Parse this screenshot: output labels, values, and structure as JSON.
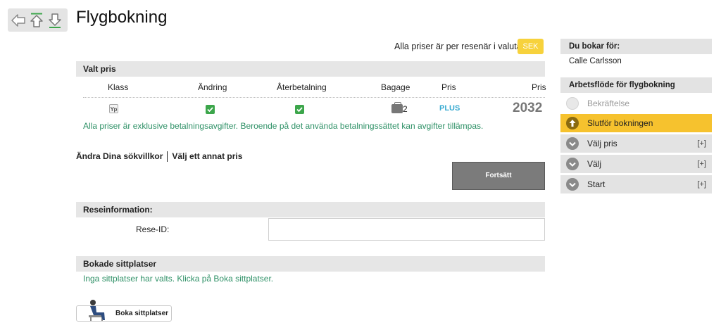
{
  "page": {
    "title": "Flygbokning"
  },
  "pricing": {
    "note": "Alla priser är per resenär i valuta",
    "currency": "SEK"
  },
  "selected_price": {
    "header": "Valt pris",
    "columns": [
      "Klass",
      "Ändring",
      "Återbetalning",
      "Bagage",
      "Pris",
      "Pris"
    ],
    "row": {
      "class_code": "Yp",
      "baggage_count": "2",
      "fare_name": "PLUS",
      "price": "2032"
    },
    "fee_note": "Alla priser är exklusive betalningsavgifter. Beroende på det använda betalningssättet kan avgifter tillämpas."
  },
  "links": {
    "change_search": "Ändra Dina sökvillkor",
    "choose_other_price": "Välj ett annat pris"
  },
  "continue_button": "Fortsätt",
  "travel_info": {
    "header": "Reseinformation:",
    "trip_id_label": "Rese-ID:",
    "trip_id_value": ""
  },
  "seats": {
    "header": "Bokade sittplatser",
    "note": "Inga sittplatser har valts. Klicka på Boka sittplatser.",
    "button": "Boka sittplatser"
  },
  "sidebar": {
    "booking_for_header": "Du bokar för:",
    "user_name": "Calle Carlsson",
    "workflow_header": "Arbetsflöde för flygbokning",
    "steps": [
      {
        "label": "Bekräftelse",
        "state": "pending",
        "expand": ""
      },
      {
        "label": "Slutför bokningen",
        "state": "current",
        "expand": ""
      },
      {
        "label": "Välj pris",
        "state": "done",
        "expand": "[+]"
      },
      {
        "label": "Välj",
        "state": "done",
        "expand": "[+]"
      },
      {
        "label": "Start",
        "state": "done",
        "expand": "[+]"
      }
    ]
  },
  "colors": {
    "accent_yellow": "#f6c22e",
    "note_green": "#2f9167",
    "fare_blue": "#35a9d0",
    "check_green": "#3ca64b"
  }
}
